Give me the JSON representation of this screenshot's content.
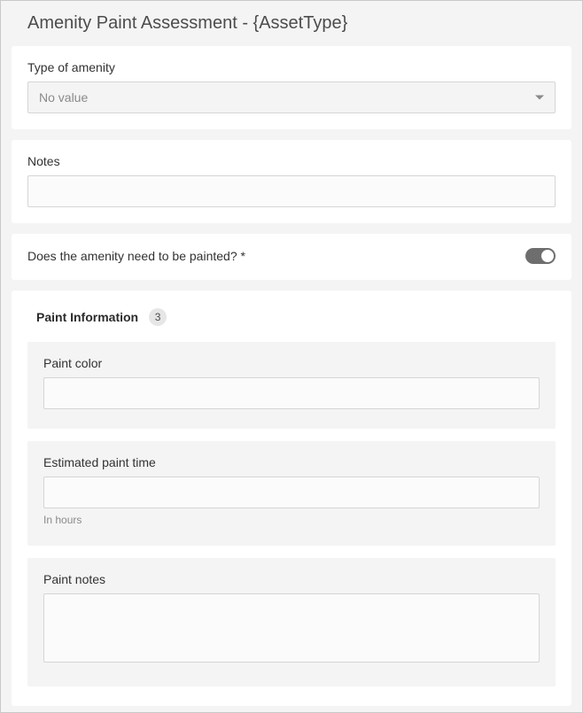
{
  "title": "Amenity Paint Assessment - {AssetType}",
  "amenity_type": {
    "label": "Type of amenity",
    "display": "No value"
  },
  "notes": {
    "label": "Notes",
    "value": ""
  },
  "needs_paint": {
    "label": "Does the amenity need to be painted? *",
    "value": true
  },
  "group": {
    "title": "Paint Information",
    "count": "3",
    "paint_color": {
      "label": "Paint color",
      "value": ""
    },
    "estimated_time": {
      "label": "Estimated paint time",
      "value": "",
      "hint": "In hours"
    },
    "paint_notes": {
      "label": "Paint notes",
      "value": ""
    }
  }
}
